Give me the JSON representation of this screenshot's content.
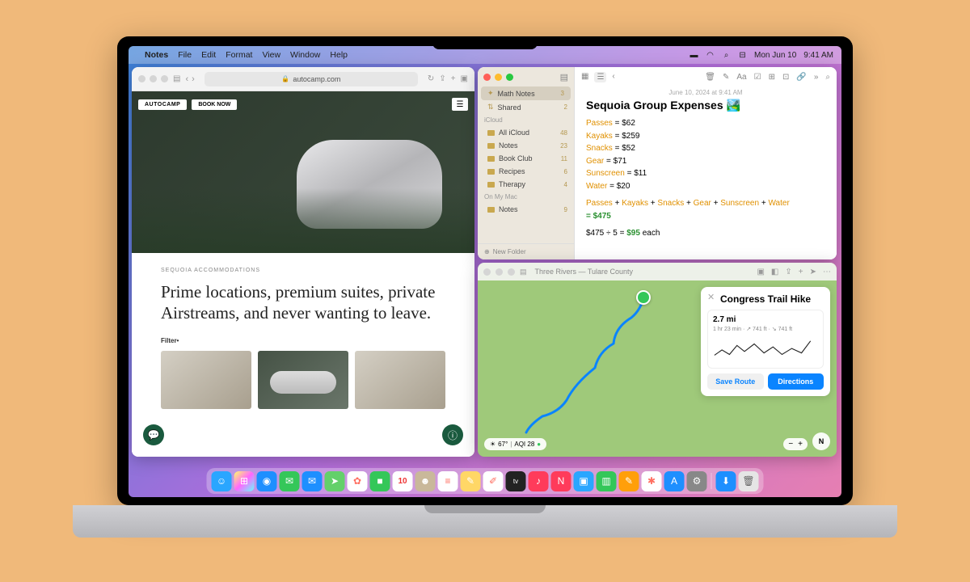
{
  "menubar": {
    "app": "Notes",
    "items": [
      "File",
      "Edit",
      "Format",
      "View",
      "Window",
      "Help"
    ],
    "date": "Mon Jun 10",
    "time": "9:41 AM"
  },
  "safari": {
    "url": "autocamp.com",
    "logo": "AUTOCAMP",
    "book": "BOOK NOW",
    "eyebrow": "SEQUOIA ACCOMMODATIONS",
    "headline": "Prime locations, premium suites, private Airstreams, and never wanting to leave.",
    "filter": "Filter•"
  },
  "notes": {
    "sidebar_top": "Math Notes",
    "sidebar_top_count": "3",
    "shared": "Shared",
    "shared_count": "2",
    "section_icloud": "iCloud",
    "folders": [
      {
        "label": "All iCloud",
        "count": "48"
      },
      {
        "label": "Notes",
        "count": "23"
      },
      {
        "label": "Book Club",
        "count": "11"
      },
      {
        "label": "Recipes",
        "count": "6"
      },
      {
        "label": "Therapy",
        "count": "4"
      }
    ],
    "section_mac": "On My Mac",
    "mac_notes": {
      "label": "Notes",
      "count": "9"
    },
    "new_folder": "New Folder",
    "date": "June 10, 2024 at 9:41 AM",
    "title": "Sequoia Group Expenses 🏞️",
    "lines": {
      "passes": "Passes",
      "passes_v": "= $62",
      "kayaks": "Kayaks",
      "kayaks_v": "= $259",
      "snacks": "Snacks",
      "snacks_v": "= $52",
      "gear": "Gear",
      "gear_v": "= $71",
      "sun": "Sunscreen",
      "sun_v": "= $11",
      "water": "Water",
      "water_v": "= $20",
      "total": "= $475",
      "div": "$475 ÷ 5 = ",
      "div_res": "$95",
      "each": " each"
    }
  },
  "maps": {
    "title": "Three Rivers — Tulare County",
    "route": {
      "name": "Congress Trail Hike",
      "distance": "2.7 mi",
      "sub": "1 hr 23 min · ↗ 741 ft · ↘ 741 ft",
      "save": "Save Route",
      "go": "Directions",
      "compass": "N"
    },
    "weather": {
      "temp": "67°",
      "aqi": "AQI 28"
    }
  },
  "dock": {
    "apps": [
      {
        "n": "finder",
        "c": "#2aa6ff",
        "g": "☺"
      },
      {
        "n": "launchpad",
        "c": "linear-gradient(135deg,#ff6,#f6f,#6ff)",
        "g": "⊞"
      },
      {
        "n": "safari",
        "c": "#1e8fff",
        "g": "◉"
      },
      {
        "n": "messages",
        "c": "#34c759",
        "g": "✉"
      },
      {
        "n": "mail",
        "c": "#1e8fff",
        "g": "✉"
      },
      {
        "n": "maps",
        "c": "#63d06a",
        "g": "➤"
      },
      {
        "n": "photos",
        "c": "#fff",
        "g": "✿"
      },
      {
        "n": "facetime",
        "c": "#34c759",
        "g": "■"
      },
      {
        "n": "calendar",
        "c": "#fff",
        "g": "10"
      },
      {
        "n": "contacts",
        "c": "#c9b89a",
        "g": "☻"
      },
      {
        "n": "reminders",
        "c": "#fff",
        "g": "≡"
      },
      {
        "n": "notes",
        "c": "#ffd766",
        "g": "✎"
      },
      {
        "n": "freeform",
        "c": "#fff",
        "g": "✐"
      },
      {
        "n": "tv",
        "c": "#222",
        "g": "tv"
      },
      {
        "n": "music",
        "c": "#ff3b5b",
        "g": "♪"
      },
      {
        "n": "news",
        "c": "#ff3b5b",
        "g": "N"
      },
      {
        "n": "keynote",
        "c": "#2aa6ff",
        "g": "▣"
      },
      {
        "n": "numbers",
        "c": "#34c759",
        "g": "▥"
      },
      {
        "n": "pages",
        "c": "#ff9f0a",
        "g": "✎"
      },
      {
        "n": "passwords",
        "c": "#fff",
        "g": "✱"
      },
      {
        "n": "appstore",
        "c": "#1e8fff",
        "g": "A"
      },
      {
        "n": "settings",
        "c": "#888",
        "g": "⚙"
      }
    ],
    "right": [
      {
        "n": "downloads",
        "c": "#1e8fff",
        "g": "⬇"
      },
      {
        "n": "trash",
        "c": "#e5e5e5",
        "g": "🗑"
      }
    ]
  }
}
